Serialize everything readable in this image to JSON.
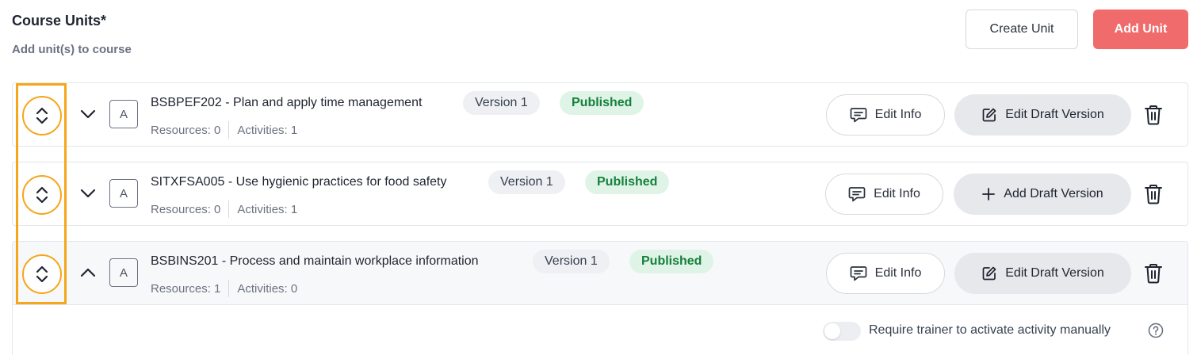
{
  "header": {
    "title": "Course Units*",
    "subtitle": "Add unit(s) to course",
    "create_unit_label": "Create Unit",
    "add_unit_label": "Add Unit"
  },
  "units": [
    {
      "letter": "A",
      "title": "BSBPEF202 - Plan and apply time management",
      "version": "Version 1",
      "status": "Published",
      "resources": "Resources: 0",
      "activities": "Activities: 1",
      "edit_info_label": "Edit Info",
      "draft_label": "Edit Draft Version",
      "draft_icon": "pencil-icon",
      "expanded": false
    },
    {
      "letter": "A",
      "title": "SITXFSA005 - Use hygienic practices for food safety",
      "version": "Version 1",
      "status": "Published",
      "resources": "Resources: 0",
      "activities": "Activities: 1",
      "edit_info_label": "Edit Info",
      "draft_label": "Add Draft Version",
      "draft_icon": "plus-icon",
      "expanded": false
    },
    {
      "letter": "A",
      "title": "BSBINS201 - Process and maintain workplace information",
      "version": "Version 1",
      "status": "Published",
      "resources": "Resources: 1",
      "activities": "Activities: 0",
      "edit_info_label": "Edit Info",
      "draft_label": "Edit Draft Version",
      "draft_icon": "pencil-icon",
      "expanded": true
    }
  ],
  "expanded_panel": {
    "toggle_label": "Require trainer to activate activity manually",
    "toggle_on": false
  },
  "colors": {
    "accent_red": "#f06b6b",
    "published_green": "#16803c",
    "highlight_orange": "#f5a61a"
  }
}
